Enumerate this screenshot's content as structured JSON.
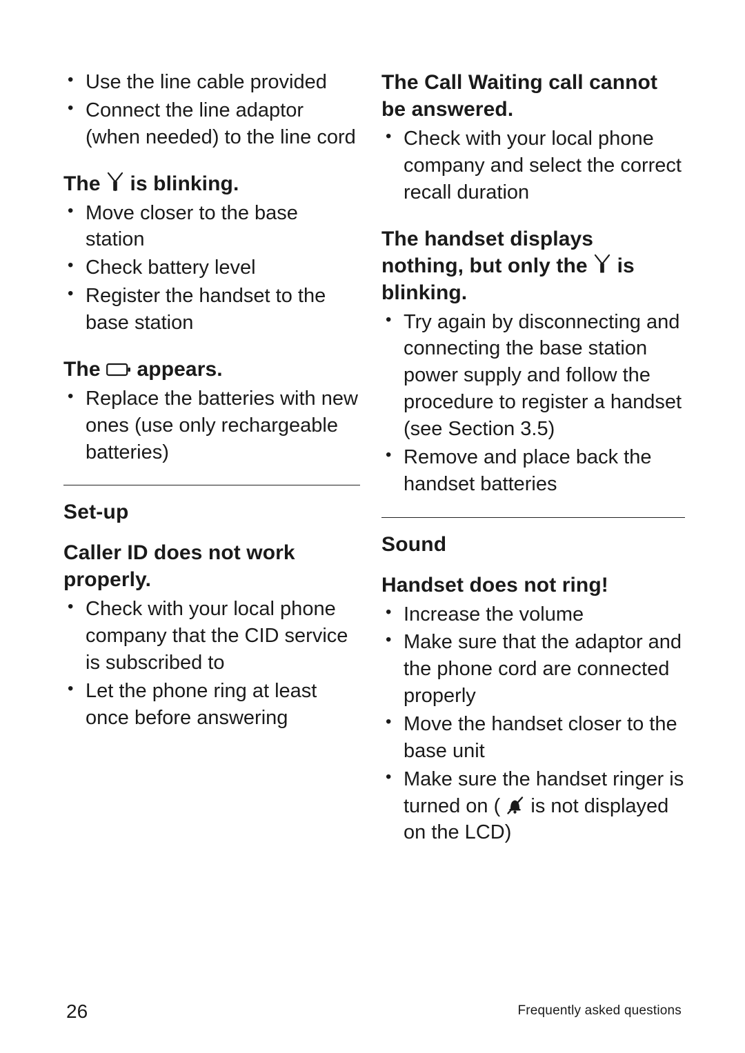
{
  "page": {
    "number": "26",
    "footer_text": "Frequently asked questions"
  },
  "left_column": {
    "top_bullets": [
      "Use the line cable provided",
      "Connect the line adaptor (when needed) to the line cord"
    ],
    "q1": {
      "head_before": "The",
      "icon": "antenna-icon",
      "head_after": "is blinking.",
      "bullets": [
        "Move closer to the base station",
        "Check battery level",
        "Register the handset to the base station"
      ]
    },
    "q2": {
      "head_before": "The",
      "icon": "battery-empty-icon",
      "head_after": "appears.",
      "bullets": [
        "Replace the batteries with new ones (use only rechargeable batteries)"
      ]
    },
    "section": {
      "title": "Set-up",
      "q3": {
        "head": "Caller ID does not work properly.",
        "bullets": [
          "Check with your local phone company that the CID service is subscribed to",
          "Let the phone ring at least once before answering"
        ]
      }
    }
  },
  "right_column": {
    "q1": {
      "head": "The Call Waiting call cannot be answered.",
      "bullets": [
        "Check with your local phone company and select the correct recall duration"
      ]
    },
    "q2": {
      "head_line1": "The handset displays",
      "head_before": "nothing, but only the",
      "icon": "antenna-icon",
      "head_after": "is",
      "head_line3": "blinking.",
      "bullets": [
        "Try again by disconnecting and connecting the base station power supply and follow the procedure to register a handset (see Section 3.5)",
        "Remove and place back the handset batteries"
      ]
    },
    "section": {
      "title": "Sound",
      "q3": {
        "head": "Handset does not ring!",
        "bullets_part1": [
          "Increase the volume",
          "Make sure that the adaptor and the phone cord are connected properly",
          "Move the handset closer to the base unit"
        ],
        "last_bullet_before": "Make sure the handset ringer is turned on (",
        "last_bullet_icon": "ringer-off-icon",
        "last_bullet_after": "is not displayed on the LCD)"
      }
    }
  }
}
